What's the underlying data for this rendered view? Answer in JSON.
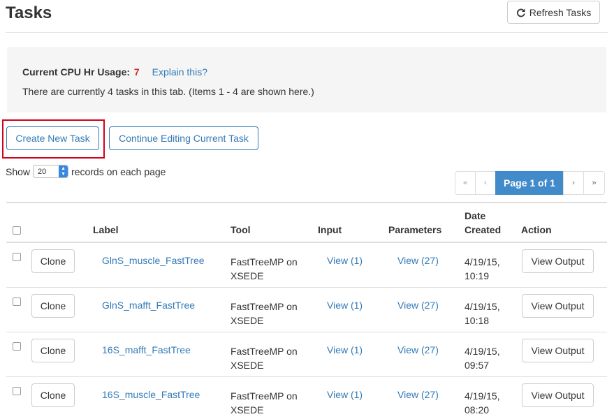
{
  "header": {
    "title": "Tasks",
    "refresh_label": "Refresh Tasks"
  },
  "info": {
    "cpu_label": "Current CPU Hr Usage:",
    "cpu_value": "7",
    "explain_link": "Explain this?",
    "task_count_text": "There are currently 4 tasks in this tab. (Items 1 - 4 are shown here.)"
  },
  "actions": {
    "create_label": "Create New Task",
    "continue_label": "Continue Editing Current Task"
  },
  "paging": {
    "show_label": "Show",
    "records_value": "20",
    "records_suffix": "records on each page",
    "first": "«",
    "prev": "‹",
    "current": "Page 1 of 1",
    "next": "›",
    "last": "»"
  },
  "table": {
    "headers": {
      "label": "Label",
      "tool": "Tool",
      "input": "Input",
      "parameters": "Parameters",
      "date_line1": "Date",
      "date_line2": "Created",
      "action": "Action"
    },
    "rows": [
      {
        "clone": "Clone",
        "label": "GlnS_muscle_FastTree",
        "tool_line1": "FastTreeMP on",
        "tool_line2": "XSEDE",
        "input": "View (1)",
        "parameters": "View (27)",
        "date_line1": "4/19/15,",
        "date_line2": "10:19",
        "action": "View Output"
      },
      {
        "clone": "Clone",
        "label": "GlnS_mafft_FastTree",
        "tool_line1": "FastTreeMP on",
        "tool_line2": "XSEDE",
        "input": "View (1)",
        "parameters": "View (27)",
        "date_line1": "4/19/15,",
        "date_line2": "10:18",
        "action": "View Output"
      },
      {
        "clone": "Clone",
        "label": "16S_mafft_FastTree",
        "tool_line1": "FastTreeMP on",
        "tool_line2": "XSEDE",
        "input": "View (1)",
        "parameters": "View (27)",
        "date_line1": "4/19/15,",
        "date_line2": "09:57",
        "action": "View Output"
      },
      {
        "clone": "Clone",
        "label": "16S_muscle_FastTree",
        "tool_line1": "FastTreeMP on",
        "tool_line2": "XSEDE",
        "input": "View (1)",
        "parameters": "View (27)",
        "date_line1": "4/19/15,",
        "date_line2": "08:20",
        "action": "View Output"
      }
    ]
  },
  "colors": {
    "link": "#337ab7",
    "cpu_value": "#c9302c",
    "pager_active": "#428bca",
    "highlight": "#d0021b"
  },
  "icons": {
    "refresh": "refresh-icon"
  }
}
